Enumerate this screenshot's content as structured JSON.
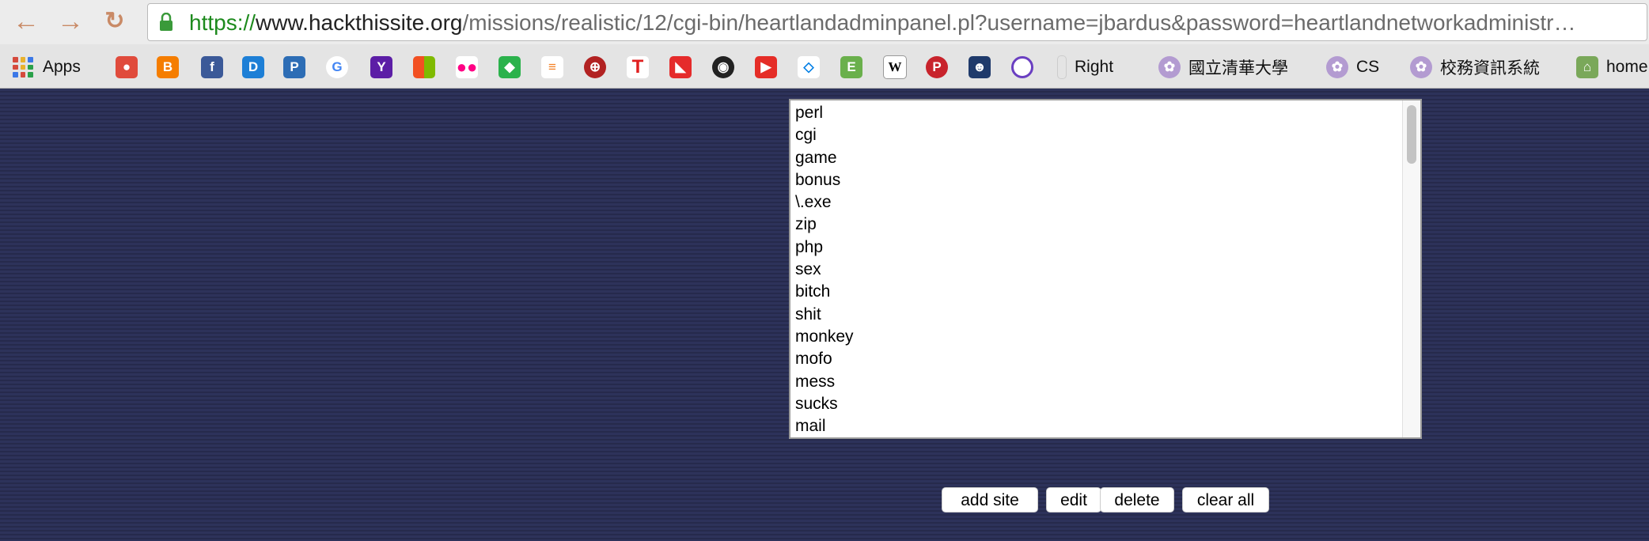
{
  "browser": {
    "url_scheme": "https://",
    "url_host": "www.hackthissite.org",
    "url_path": "/missions/realistic/12/cgi-bin/heartlandadminpanel.pl?username=jbardus&password=heartlandnetworkadministr…"
  },
  "bookmarks": {
    "apps": "Apps",
    "right": "Right",
    "nthu": "國立清華大學",
    "cs": "CS",
    "school_system": "校務資訊系統",
    "home": "home"
  },
  "filter_list": {
    "items": [
      "perl",
      "cgi",
      "game",
      "bonus",
      "\\.exe",
      "zip",
      "php",
      "sex",
      "bitch",
      "shit",
      "monkey",
      "mofo",
      "mess",
      "sucks",
      "mail"
    ]
  },
  "actions": {
    "add_site": "add site",
    "edit": "edit",
    "delete": "delete",
    "clear_all": "clear all"
  }
}
